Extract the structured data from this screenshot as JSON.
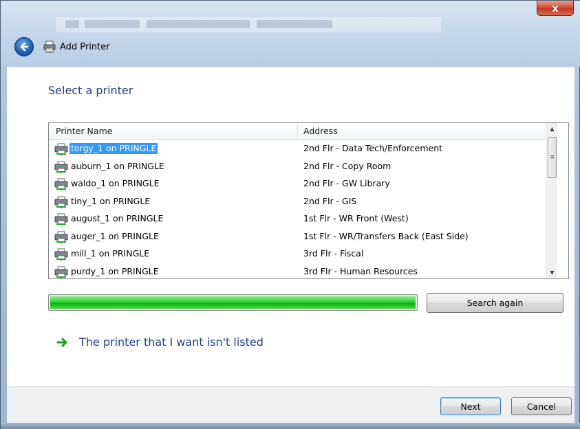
{
  "window": {
    "close_glyph": "x",
    "title": "Add Printer"
  },
  "heading": "Select a printer",
  "list": {
    "columns": [
      "Printer Name",
      "Address"
    ],
    "rows": [
      {
        "name": "torgy_1 on PRINGLE",
        "address": "2nd Flr - Data Tech/Enforcement",
        "selected": true
      },
      {
        "name": "auburn_1 on PRINGLE",
        "address": "2nd Flr - Copy Room"
      },
      {
        "name": "waldo_1 on PRINGLE",
        "address": "2nd Flr - GW Library"
      },
      {
        "name": "tiny_1 on PRINGLE",
        "address": "2nd Flr - GIS"
      },
      {
        "name": "august_1 on PRINGLE",
        "address": "1st Flr - WR Front (West)"
      },
      {
        "name": "auger_1 on PRINGLE",
        "address": "1st Flr - WR/Transfers Back (East Side)"
      },
      {
        "name": "mill_1 on PRINGLE",
        "address": "3rd Flr - Fiscal"
      },
      {
        "name": "purdy_1 on PRINGLE",
        "address": "3rd Flr - Human Resources"
      }
    ]
  },
  "progress": {
    "value_percent": 100,
    "color": "#22c422"
  },
  "search_again_label": "Search again",
  "missing_printer_link": "The printer that I want isn't listed",
  "buttons": {
    "next": "Next",
    "cancel": "Cancel"
  },
  "colors": {
    "heading": "#1e3d8f",
    "selection": "#3399ff",
    "close_button": "#c13a23"
  },
  "icons": [
    "back-arrow-icon",
    "printer-icon",
    "network-printer-icon",
    "green-arrow-icon",
    "scroll-up-icon",
    "scroll-down-icon"
  ]
}
